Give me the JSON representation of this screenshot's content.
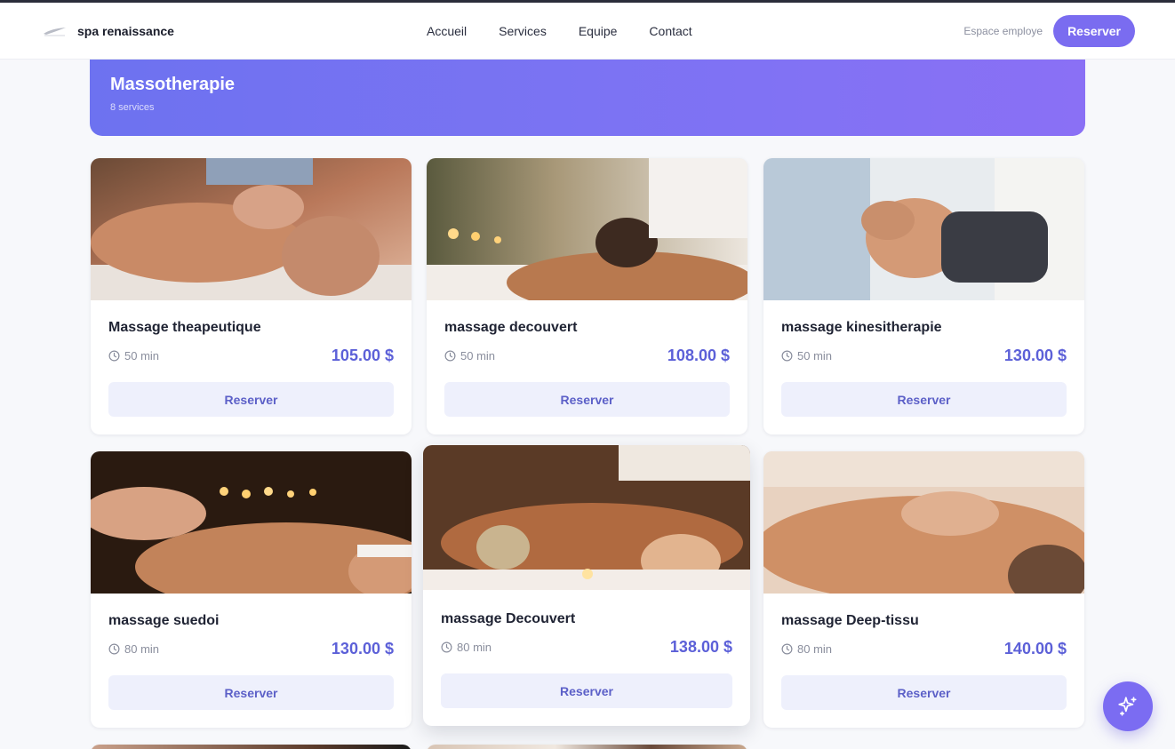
{
  "header": {
    "brand": "spa renaissance",
    "nav": [
      "Accueil",
      "Services",
      "Equipe",
      "Contact"
    ],
    "staff_link": "Espace employe",
    "cta": "Reserver"
  },
  "category": {
    "title": "Massotherapie",
    "count": "8 services"
  },
  "services": [
    {
      "name": "Massage theapeutique",
      "duration": "50 min",
      "price": "105.00 $",
      "button": "Reserver"
    },
    {
      "name": "massage decouvert",
      "duration": "50 min",
      "price": "108.00 $",
      "button": "Reserver"
    },
    {
      "name": "massage kinesitherapie",
      "duration": "50 min",
      "price": "130.00 $",
      "button": "Reserver"
    },
    {
      "name": "massage suedoi",
      "duration": "80 min",
      "price": "130.00 $",
      "button": "Reserver"
    },
    {
      "name": "massage Decouvert",
      "duration": "80 min",
      "price": "138.00 $",
      "button": "Reserver"
    },
    {
      "name": "massage Deep-tissu",
      "duration": "80 min",
      "price": "140.00 $",
      "button": "Reserver"
    }
  ],
  "colors": {
    "accent": "#7a6cf0",
    "price": "#5c60d8",
    "hero_start": "#6d72f0",
    "hero_end": "#8a70f5"
  },
  "icons": [
    "logo-icon",
    "clock-icon",
    "sparkles-icon"
  ]
}
